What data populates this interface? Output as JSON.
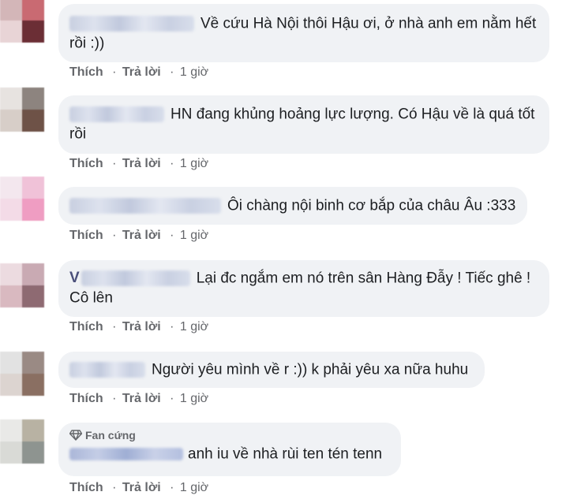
{
  "comments": [
    {
      "text": "Về cứu Hà Nội thôi Hậu ơi, ở nhà anh em nằm hết rồi :))",
      "actions": {
        "like": "Thích",
        "reply": "Trả lời",
        "sep": "·",
        "time": "1 giờ"
      },
      "avatar_colors": [
        "#d3b6b8",
        "#c96a72",
        "#e8d4d6",
        "#6b2e35"
      ]
    },
    {
      "text": "HN đang khủng hoảng lực lượng. Có Hậu về là quá tốt rồi",
      "actions": {
        "like": "Thích",
        "reply": "Trả lời",
        "sep": "·",
        "time": "1 giờ"
      },
      "avatar_colors": [
        "#e7e3e0",
        "#8d847f",
        "#d7cec8",
        "#6e5247"
      ]
    },
    {
      "text": "Ôi chàng nội binh cơ bắp của châu Âu :333",
      "actions": {
        "like": "Thích",
        "reply": "Trả lời",
        "sep": "·",
        "time": "1 giờ"
      },
      "avatar_colors": [
        "#f3e7ee",
        "#f0c2d8",
        "#f3dbe7",
        "#ef9dc2"
      ]
    },
    {
      "text": "Lại đc ngắm em nó trên sân Hàng Đẫy ! Tiếc ghê ! Cô lên",
      "name_fragment": "V",
      "actions": {
        "like": "Thích",
        "reply": "Trả lời",
        "sep": "·",
        "time": "1 giờ"
      },
      "avatar_colors": [
        "#ecdbe0",
        "#c9aab3",
        "#d9b9c0",
        "#8e6a72"
      ]
    },
    {
      "text": "Người yêu mình về r :)) k phải yêu xa nữa huhu",
      "actions": {
        "like": "Thích",
        "reply": "Trả lời",
        "sep": "·",
        "time": "1 giờ"
      },
      "avatar_colors": [
        "#e2e2e2",
        "#9a8a84",
        "#dcd4d0",
        "#8a6f62"
      ]
    },
    {
      "badge": "Fan cứng",
      "text": "anh iu về nhà rùi ten tén tenn",
      "actions": {
        "like": "Thích",
        "reply": "Trả lời",
        "sep": "·",
        "time": "1 giờ"
      },
      "avatar_colors": [
        "#e9e9e7",
        "#b8b2a3",
        "#d9dad6",
        "#8e9490"
      ]
    }
  ]
}
